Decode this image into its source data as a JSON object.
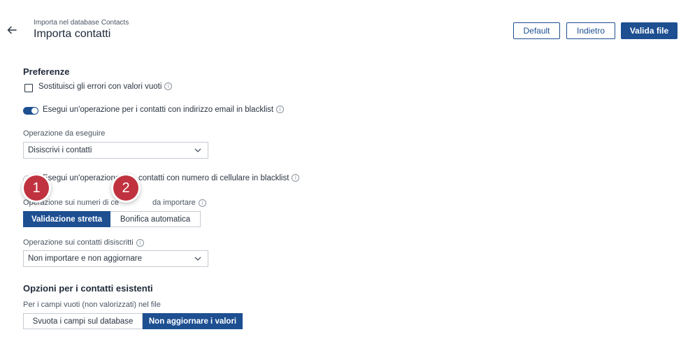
{
  "header": {
    "subtitle": "Importa nel database Contacts",
    "title": "Importa contatti",
    "buttons": {
      "default": "Default",
      "back": "Indietro",
      "validate": "Valida file"
    }
  },
  "preferences": {
    "title": "Preferenze",
    "replace_errors_label": "Sostituisci gli errori con valori vuoti",
    "replace_errors_checked": false,
    "email_blacklist_label": "Esegui un'operazione per i contatti con indirizzo email in blacklist",
    "email_blacklist_enabled": true,
    "operation_label": "Operazione da eseguire",
    "operation_value": "Disiscrivi i contatti",
    "mobile_blacklist_label_part1": "Esegui un'operazione",
    "mobile_blacklist_label_part2": "contatti con numero di cellulare in blacklist",
    "mobile_blacklist_enabled": false,
    "mobile_import_label_part1": "Operazione sui numeri di ce",
    "mobile_import_label_part2": "da importare",
    "mobile_options": [
      "Validazione stretta",
      "Bonifica automatica"
    ],
    "mobile_selected": "Validazione stretta",
    "unsubscribed_label": "Operazione sui contatti disiscritti",
    "unsubscribed_value": "Non importare e non aggiornare"
  },
  "existing": {
    "title": "Opzioni per i contatti esistenti",
    "empty_fields_label": "Per i campi vuoti (non valorizzati) nel file",
    "options": [
      "Svuota i campi sul database",
      "Non aggiornare i valori"
    ],
    "selected": "Non aggiornare i valori"
  },
  "markers": [
    "1",
    "2"
  ],
  "icons": {
    "back": "arrow-left-icon",
    "info": "info-icon",
    "chevron": "chevron-down-icon"
  },
  "colors": {
    "primary": "#1d4f91",
    "marker": "#c0323f"
  }
}
